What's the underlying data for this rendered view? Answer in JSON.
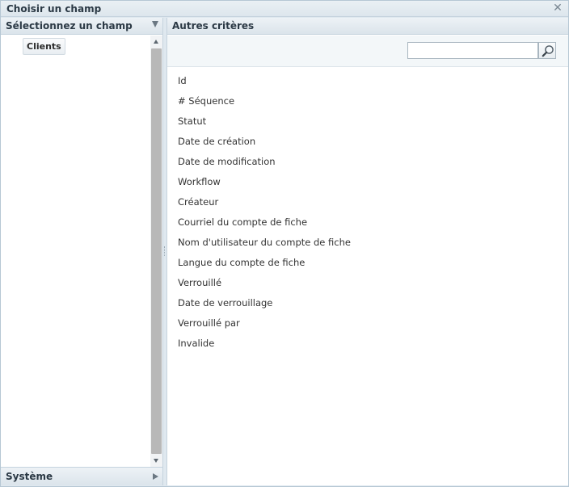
{
  "dialog": {
    "title": "Choisir un champ"
  },
  "left_panel": {
    "header": "Sélectionnez un champ",
    "tree_node": "Clients",
    "footer": "Système"
  },
  "right_panel": {
    "header": "Autres critères",
    "search": {
      "value": "",
      "placeholder": ""
    },
    "fields": [
      "Id",
      "# Séquence",
      "Statut",
      "Date de création",
      "Date de modification",
      "Workflow",
      "Créateur",
      "Courriel du compte de fiche",
      "Nom d'utilisateur du compte de fiche",
      "Langue du compte de fiche",
      "Verrouillé",
      "Date de verrouillage",
      "Verrouillé par",
      "Invalide"
    ]
  },
  "icons": {
    "close": "close-icon",
    "search": "magnifier-icon",
    "collapse": "chevron-down-icon",
    "expand": "chevron-right-icon"
  }
}
